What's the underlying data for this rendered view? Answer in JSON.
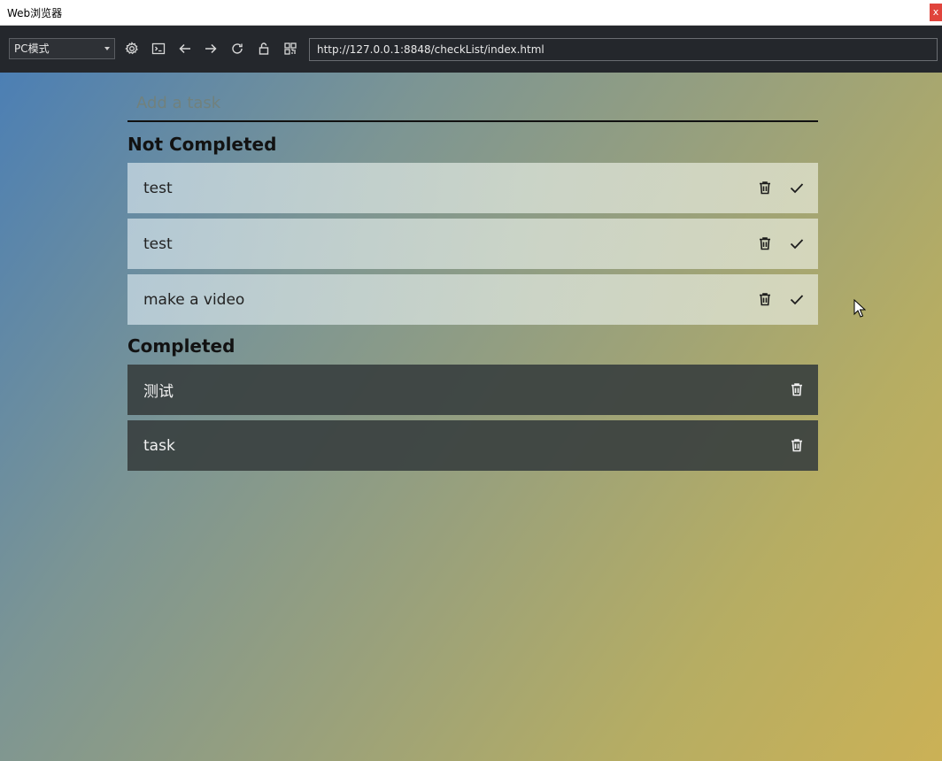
{
  "window": {
    "title": "Web浏览器",
    "close_label": "x"
  },
  "toolbar": {
    "mode": "PC模式",
    "url": "http://127.0.0.1:8848/checkList/index.html",
    "icons": [
      "settings-icon",
      "console-icon",
      "back-icon",
      "forward-icon",
      "reload-icon",
      "lock-icon",
      "qr-code-icon"
    ]
  },
  "app": {
    "input_placeholder": "Add a task",
    "not_completed_title": "Not Completed",
    "completed_title": "Completed",
    "not_completed": [
      {
        "text": "test"
      },
      {
        "text": "test"
      },
      {
        "text": "make a video"
      }
    ],
    "completed": [
      {
        "text": "测试"
      },
      {
        "text": "task"
      }
    ]
  },
  "colors": {
    "toolbar_bg": "#24272c",
    "completed_bg": "#373e3e",
    "gradient_start": "#4c7fb4",
    "gradient_end": "#cbb156"
  }
}
